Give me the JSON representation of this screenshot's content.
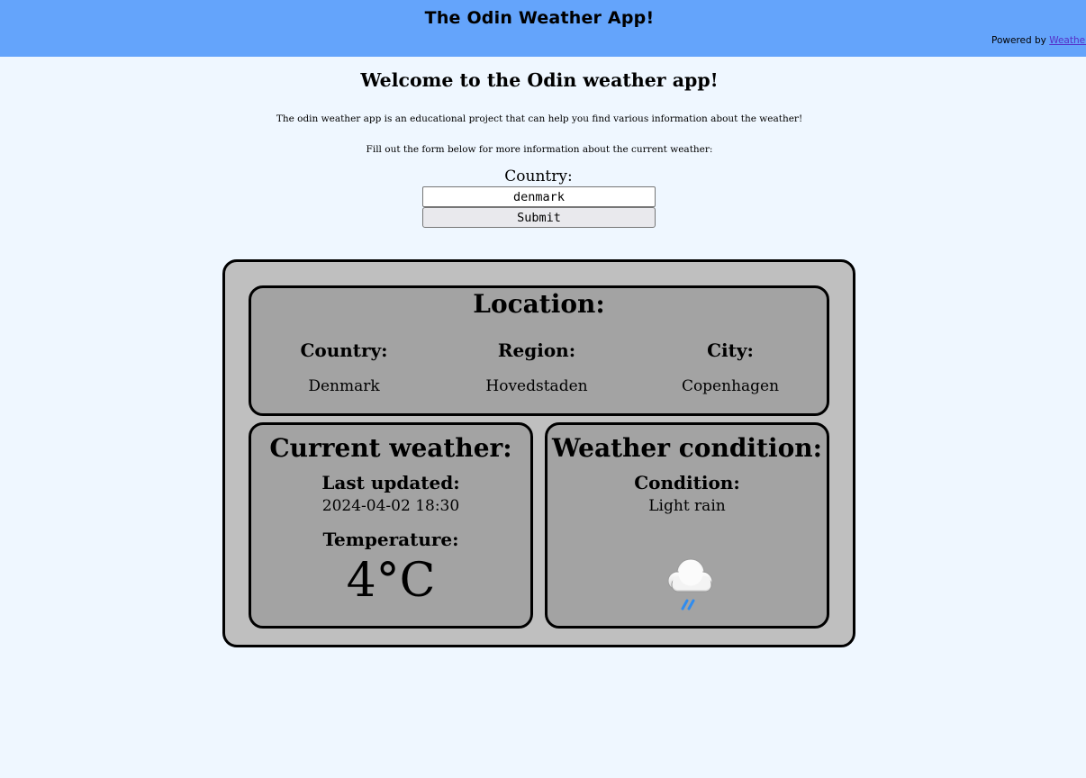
{
  "header": {
    "title": "The Odin Weather App!",
    "powered_prefix": "Powered by ",
    "powered_link": "WeatherAPI"
  },
  "intro": {
    "heading": "Welcome to the Odin weather app!",
    "description": "The odin weather app is an educational project that can help you find various information about the weather!",
    "form_hint": "Fill out the form below for more information about the current weather:"
  },
  "form": {
    "country_label": "Country:",
    "country_value": "denmark",
    "submit_label": "Submit"
  },
  "location": {
    "title": "Location:",
    "country_label": "Country:",
    "country": "Denmark",
    "region_label": "Region:",
    "region": "Hovedstaden",
    "city_label": "City:",
    "city": "Copenhagen"
  },
  "current": {
    "title": "Current weather:",
    "updated_label": "Last updated:",
    "updated": "2024-04-02 18:30",
    "temp_label": "Temperature:",
    "temp": "4°C"
  },
  "condition": {
    "title": "Weather condition:",
    "label": "Condition:",
    "value": "Light rain",
    "icon": "light-rain-cloud-icon"
  },
  "colors": {
    "header_bg": "#64a4fb",
    "page_bg": "#eff7ff",
    "outer_card": "#bfbfbf",
    "panel": "#a3a3a3",
    "rain": "#2f8cf0"
  }
}
